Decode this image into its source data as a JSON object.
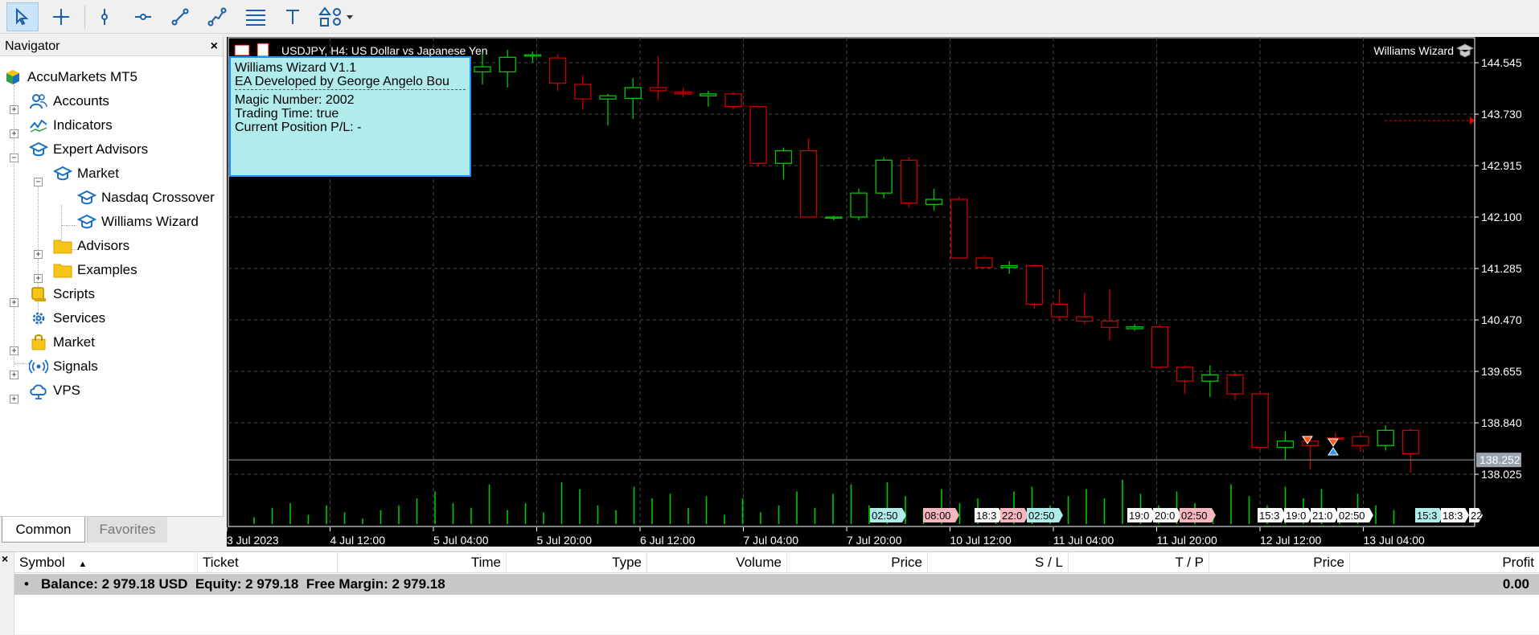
{
  "toolbar": {
    "buttons": [
      {
        "name": "cursor-icon",
        "active": true
      },
      {
        "name": "crosshair-icon"
      },
      {
        "name": "vertical-line-icon"
      },
      {
        "name": "horizontal-line-icon"
      },
      {
        "name": "trendline-icon"
      },
      {
        "name": "multi-segment-icon"
      },
      {
        "name": "fibonacci-icon"
      },
      {
        "name": "text-tool-icon"
      },
      {
        "name": "shapes-icon"
      }
    ]
  },
  "navigator": {
    "title": "Navigator",
    "close": "×",
    "items": [
      {
        "label": "AccuMarkets MT5",
        "icon": "broker-icon"
      },
      {
        "label": "Accounts",
        "icon": "accounts-icon"
      },
      {
        "label": "Indicators",
        "icon": "indicators-icon"
      },
      {
        "label": "Expert Advisors",
        "icon": "expert-advisor-icon"
      },
      {
        "label": "Market",
        "icon": "expert-advisor-icon"
      },
      {
        "label": "Nasdaq Crossover",
        "icon": "expert-advisor-icon"
      },
      {
        "label": "Williams Wizard",
        "icon": "expert-advisor-icon"
      },
      {
        "label": "Advisors",
        "icon": "folder-icon"
      },
      {
        "label": "Examples",
        "icon": "folder-icon"
      },
      {
        "label": "Scripts",
        "icon": "scripts-icon"
      },
      {
        "label": "Services",
        "icon": "services-icon"
      },
      {
        "label": "Market",
        "icon": "market-bag-icon"
      },
      {
        "label": "Signals",
        "icon": "signals-icon"
      },
      {
        "label": "VPS",
        "icon": "vps-cloud-icon"
      }
    ],
    "tabs": [
      "Common",
      "Favorites"
    ]
  },
  "chart": {
    "symbol_title": "USDJPY, H4:  US Dollar vs Japanese Yen",
    "ea_label": "Williams Wizard",
    "info_panel": {
      "line1": "Williams Wizard V1.1",
      "line2": "EA Developed by George Angelo Bou",
      "line3": "Magic Number: 2002",
      "line4": "Trading Time: true",
      "line5": "Current Position P/L: -"
    },
    "price_labels": [
      "144.545",
      "143.730",
      "142.915",
      "142.100",
      "141.285",
      "140.470",
      "139.655",
      "138.840",
      "138.025"
    ],
    "current_price": "138.252",
    "time_labels": [
      "3 Jul 2023",
      "4 Jul 12:00",
      "5 Jul 04:00",
      "5 Jul 20:00",
      "6 Jul 12:00",
      "7 Jul 04:00",
      "7 Jul 20:00",
      "10 Jul 12:00",
      "11 Jul 04:00",
      "11 Jul 20:00",
      "12 Jul 12:00",
      "13 Jul 04:00"
    ],
    "event_markers": [
      {
        "text": "02:50",
        "color": "#b0ecec"
      },
      {
        "text": "08:00",
        "color": "#f4b6bf"
      },
      {
        "text": "18:3",
        "color": "#ffffff"
      },
      {
        "text": "22:0",
        "color": "#f4b6bf"
      },
      {
        "text": "02:50",
        "color": "#b0ecec"
      },
      {
        "text": "19:0",
        "color": "#ffffff"
      },
      {
        "text": "20:0",
        "color": "#ffffff"
      },
      {
        "text": "02:50",
        "color": "#f4b6bf"
      },
      {
        "text": "15:3",
        "color": "#ffffff"
      },
      {
        "text": "19:0",
        "color": "#ffffff"
      },
      {
        "text": "21:0",
        "color": "#ffffff"
      },
      {
        "text": "02:50",
        "color": "#ffffff"
      },
      {
        "text": "15:3",
        "color": "#b0ecec"
      },
      {
        "text": "18:3",
        "color": "#ffffff"
      },
      {
        "text": "22",
        "color": "#ffffff"
      }
    ],
    "colors": {
      "bull": "#00c800",
      "bear": "#c80000",
      "grid": "#4a4a4a",
      "axis_text": "#ffffff",
      "volume": "#00c800"
    }
  },
  "chart_data": {
    "type": "candlestick",
    "symbol": "USDJPY",
    "timeframe": "H4",
    "ylim": [
      137.8,
      144.8
    ],
    "x": [
      "3 Jul 2023",
      "4 Jul 12:00",
      "5 Jul 04:00",
      "5 Jul 20:00",
      "6 Jul 12:00",
      "7 Jul 04:00",
      "7 Jul 20:00",
      "10 Jul 12:00",
      "11 Jul 04:00",
      "11 Jul 20:00",
      "12 Jul 12:00",
      "13 Jul 04:00"
    ],
    "candles": [
      {
        "o": 144.4,
        "h": 144.7,
        "l": 144.2,
        "c": 144.48
      },
      {
        "o": 144.4,
        "h": 144.75,
        "l": 144.15,
        "c": 144.63
      },
      {
        "o": 144.65,
        "h": 144.72,
        "l": 144.55,
        "c": 144.67
      },
      {
        "o": 144.62,
        "h": 144.68,
        "l": 144.1,
        "c": 144.22
      },
      {
        "o": 144.2,
        "h": 144.35,
        "l": 143.8,
        "c": 143.97
      },
      {
        "o": 143.97,
        "h": 144.05,
        "l": 143.55,
        "c": 144.02
      },
      {
        "o": 143.98,
        "h": 144.3,
        "l": 143.65,
        "c": 144.15
      },
      {
        "o": 144.15,
        "h": 144.65,
        "l": 143.95,
        "c": 144.1
      },
      {
        "o": 144.08,
        "h": 144.15,
        "l": 144.0,
        "c": 144.05
      },
      {
        "o": 144.02,
        "h": 144.1,
        "l": 143.85,
        "c": 144.05
      },
      {
        "o": 144.05,
        "h": 144.08,
        "l": 143.8,
        "c": 143.85
      },
      {
        "o": 143.85,
        "h": 143.85,
        "l": 142.9,
        "c": 142.95
      },
      {
        "o": 142.95,
        "h": 143.2,
        "l": 142.7,
        "c": 143.15
      },
      {
        "o": 143.15,
        "h": 143.35,
        "l": 142.1,
        "c": 142.1
      },
      {
        "o": 142.1,
        "h": 142.12,
        "l": 142.05,
        "c": 142.1
      },
      {
        "o": 142.1,
        "h": 142.55,
        "l": 142.05,
        "c": 142.48
      },
      {
        "o": 142.48,
        "h": 143.05,
        "l": 142.4,
        "c": 143.0
      },
      {
        "o": 143.0,
        "h": 143.05,
        "l": 142.25,
        "c": 142.32
      },
      {
        "o": 142.3,
        "h": 142.55,
        "l": 142.2,
        "c": 142.38
      },
      {
        "o": 142.38,
        "h": 142.42,
        "l": 141.45,
        "c": 141.45
      },
      {
        "o": 141.45,
        "h": 141.48,
        "l": 141.28,
        "c": 141.3
      },
      {
        "o": 141.3,
        "h": 141.4,
        "l": 141.2,
        "c": 141.33
      },
      {
        "o": 141.33,
        "h": 141.35,
        "l": 140.65,
        "c": 140.72
      },
      {
        "o": 140.72,
        "h": 140.95,
        "l": 140.45,
        "c": 140.52
      },
      {
        "o": 140.52,
        "h": 140.9,
        "l": 140.4,
        "c": 140.45
      },
      {
        "o": 140.45,
        "h": 140.95,
        "l": 140.15,
        "c": 140.35
      },
      {
        "o": 140.33,
        "h": 140.4,
        "l": 140.3,
        "c": 140.36
      },
      {
        "o": 140.36,
        "h": 140.4,
        "l": 139.7,
        "c": 139.72
      },
      {
        "o": 139.72,
        "h": 139.75,
        "l": 139.3,
        "c": 139.5
      },
      {
        "o": 139.5,
        "h": 139.75,
        "l": 139.25,
        "c": 139.6
      },
      {
        "o": 139.6,
        "h": 139.65,
        "l": 139.2,
        "c": 139.3
      },
      {
        "o": 139.3,
        "h": 139.35,
        "l": 138.4,
        "c": 138.45
      },
      {
        "o": 138.45,
        "h": 138.7,
        "l": 138.25,
        "c": 138.55
      },
      {
        "o": 138.55,
        "h": 138.65,
        "l": 138.1,
        "c": 138.48
      },
      {
        "o": 138.6,
        "h": 138.68,
        "l": 138.52,
        "c": 138.58
      },
      {
        "o": 138.62,
        "h": 138.7,
        "l": 138.38,
        "c": 138.48
      },
      {
        "o": 138.48,
        "h": 138.8,
        "l": 138.4,
        "c": 138.72
      },
      {
        "o": 138.72,
        "h": 138.75,
        "l": 138.05,
        "c": 138.35
      }
    ],
    "volume": [
      0.15,
      0.35,
      0.45,
      0.2,
      0.4,
      0.25,
      0.12,
      0.3,
      0.4,
      0.55,
      0.7,
      0.45,
      0.35,
      0.85,
      0.3,
      0.45,
      0.25,
      0.9,
      0.75,
      0.4,
      0.3,
      0.8,
      0.55,
      0.65,
      0.35,
      0.6,
      0.2,
      0.55,
      0.25,
      0.4,
      0.7,
      0.35,
      0.65,
      0.85,
      0.4,
      0.9,
      0.6,
      0.3,
      0.75,
      0.45,
      0.55,
      0.35,
      0.7,
      0.8,
      0.4,
      0.6,
      0.75,
      0.55,
      0.95,
      0.65,
      0.4,
      0.7,
      0.45,
      0.3,
      0.85,
      0.6,
      0.4,
      0.8,
      0.55,
      0.75,
      0.35,
      0.65,
      0.4,
      0.3
    ]
  },
  "terminal": {
    "close": "×",
    "columns": [
      "Symbol",
      "Ticket",
      "Time",
      "Type",
      "Volume",
      "Price",
      "S / L",
      "T / P",
      "Price",
      "Profit"
    ],
    "sort_indicator": "▲",
    "balance_row": "Balance: 2 979.18 USD  Equity: 2 979.18  Free Margin: 2 979.18",
    "profit": "0.00",
    "bullet": "•"
  }
}
